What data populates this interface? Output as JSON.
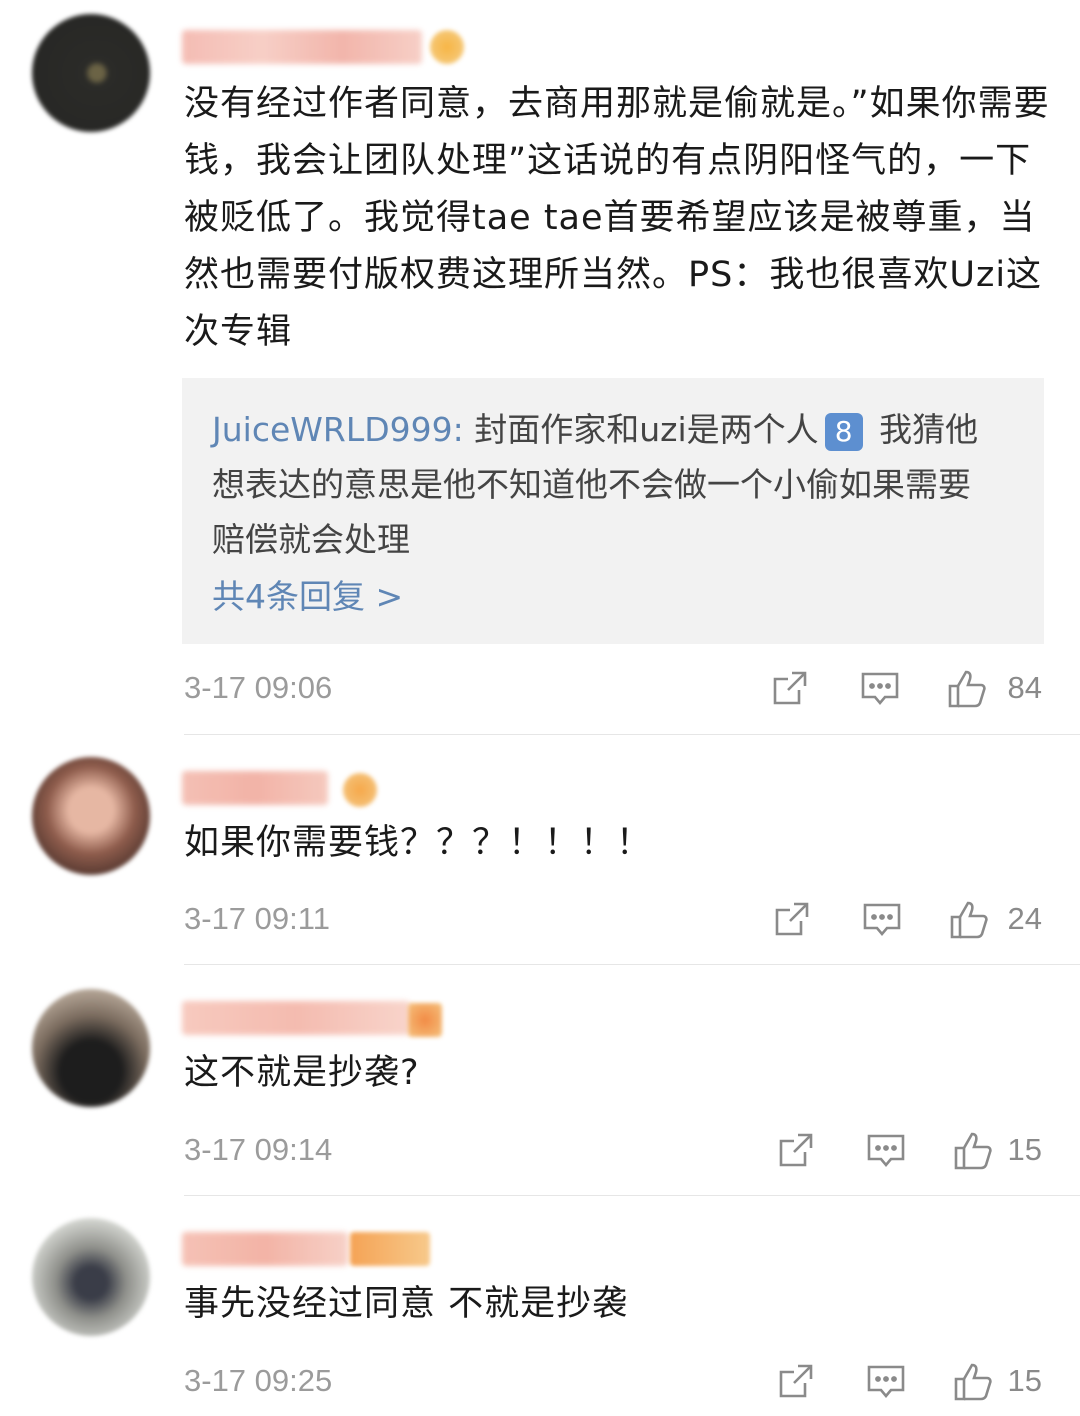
{
  "comments": [
    {
      "text": "没有经过作者同意，去商用那就是偷就是。”如果你需要钱，我会让团队处理”这话说的有点阴阳怪气的，一下被贬低了。我觉得tae tae首要希望应该是被尊重，当然也需要付版权费这理所当然。PS：我也很喜欢Uzi这次专辑",
      "reply": {
        "user": "JuiceWRLD999:",
        "text_before": " 封面作家和uzi是两个人",
        "badge": "8",
        "text_after": " 我猜他想表达的意思是他不知道他不会做一个小偷如果需要赔偿就会处理",
        "more": "共4条回复 >"
      },
      "time": "3-17 09:06",
      "likes": "84"
    },
    {
      "text": "如果你需要钱？？？！！！！",
      "time": "3-17 09:11",
      "likes": "24"
    },
    {
      "text": "这不就是抄袭?",
      "time": "3-17 09:14",
      "likes": "15"
    },
    {
      "text": "事先没经过同意 不就是抄袭",
      "time": "3-17 09:25",
      "likes": "15"
    }
  ],
  "icons": [
    "share-icon",
    "comment-icon",
    "like-icon"
  ],
  "colors": {
    "link": "#5f86b5",
    "muted": "#9b9b9b",
    "reply_bg": "#f2f2f2"
  }
}
